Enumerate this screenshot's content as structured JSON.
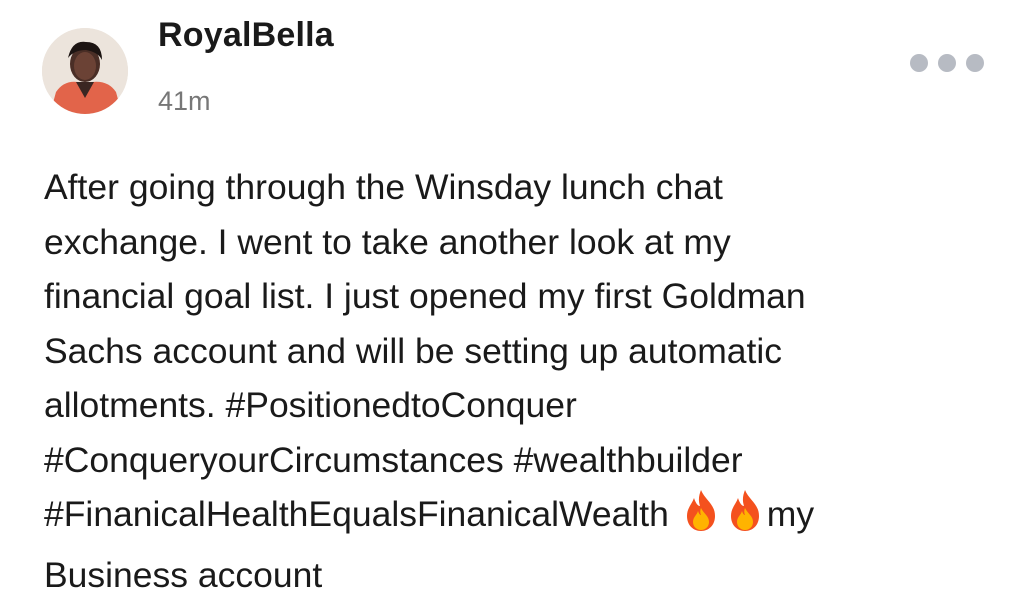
{
  "post": {
    "author": "RoyalBella",
    "timestamp": "41m",
    "avatar_icon": "user-avatar-photo",
    "more_icon": "more-horizontal-dots-icon",
    "lines": [
      "After going through the Winsday lunch chat",
      "exchange. I went to take another look at my",
      "financial goal list. I just opened my first Goldman",
      "Sachs account and will be setting up automatic",
      "allotments. #PositionedtoConquer",
      "#ConqueryourCircumstances #wealthbuilder",
      "#FinanicalHealthEqualsFinanicalWealth",
      "my",
      "Business account"
    ],
    "emoji_icon": "fire-emoji-icon",
    "colors": {
      "text": "#1a1a1a",
      "muted": "#777777",
      "dots": "#b7bbc3",
      "fire_outer": "#f4511e",
      "fire_inner": "#ffb300"
    }
  }
}
